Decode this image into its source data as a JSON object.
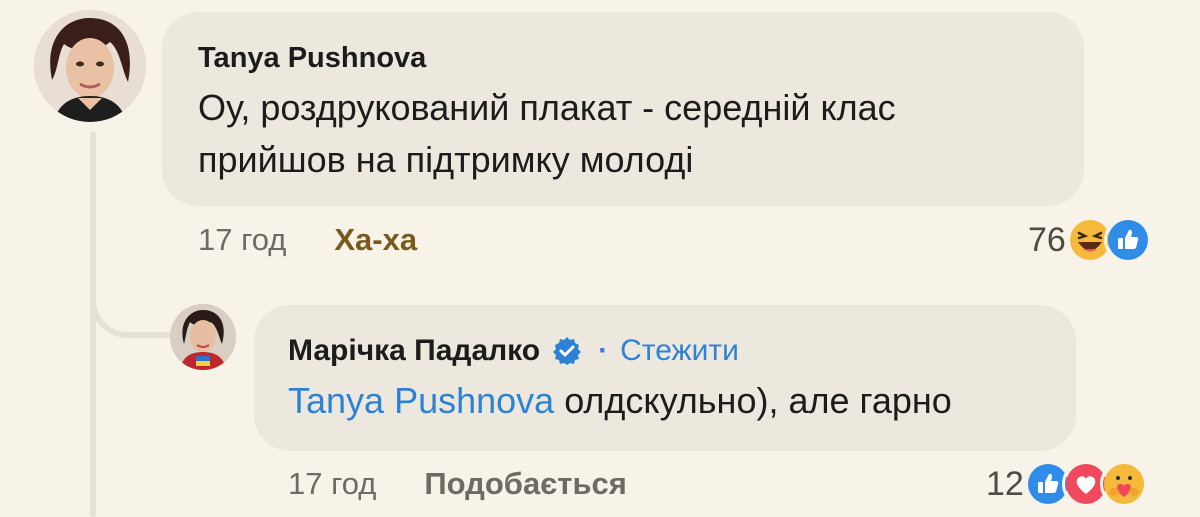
{
  "comment": {
    "author": "Tanya Pushnova",
    "text": "Оу, роздрукований плакат - середній клас прийшов на підтримку молоді",
    "time": "17 год",
    "reaction_label": "Ха-ха",
    "reaction_count": "76",
    "reaction_icons": [
      "haha-icon",
      "like-icon"
    ]
  },
  "reply": {
    "author": "Марічка Падалко",
    "follow_label": "Стежити",
    "separator": "·",
    "mention": "Tanya Pushnova",
    "text": " олдскульно), але гарно",
    "time": "17 год",
    "like_label": "Подобається",
    "reaction_count": "12",
    "reaction_icons": [
      "like-icon",
      "love-icon",
      "care-icon"
    ]
  },
  "colors": {
    "background": "#f8f3e9",
    "bubble": "#ede8de",
    "link": "#2e82d4",
    "haha_active": "#7a5a1c"
  }
}
